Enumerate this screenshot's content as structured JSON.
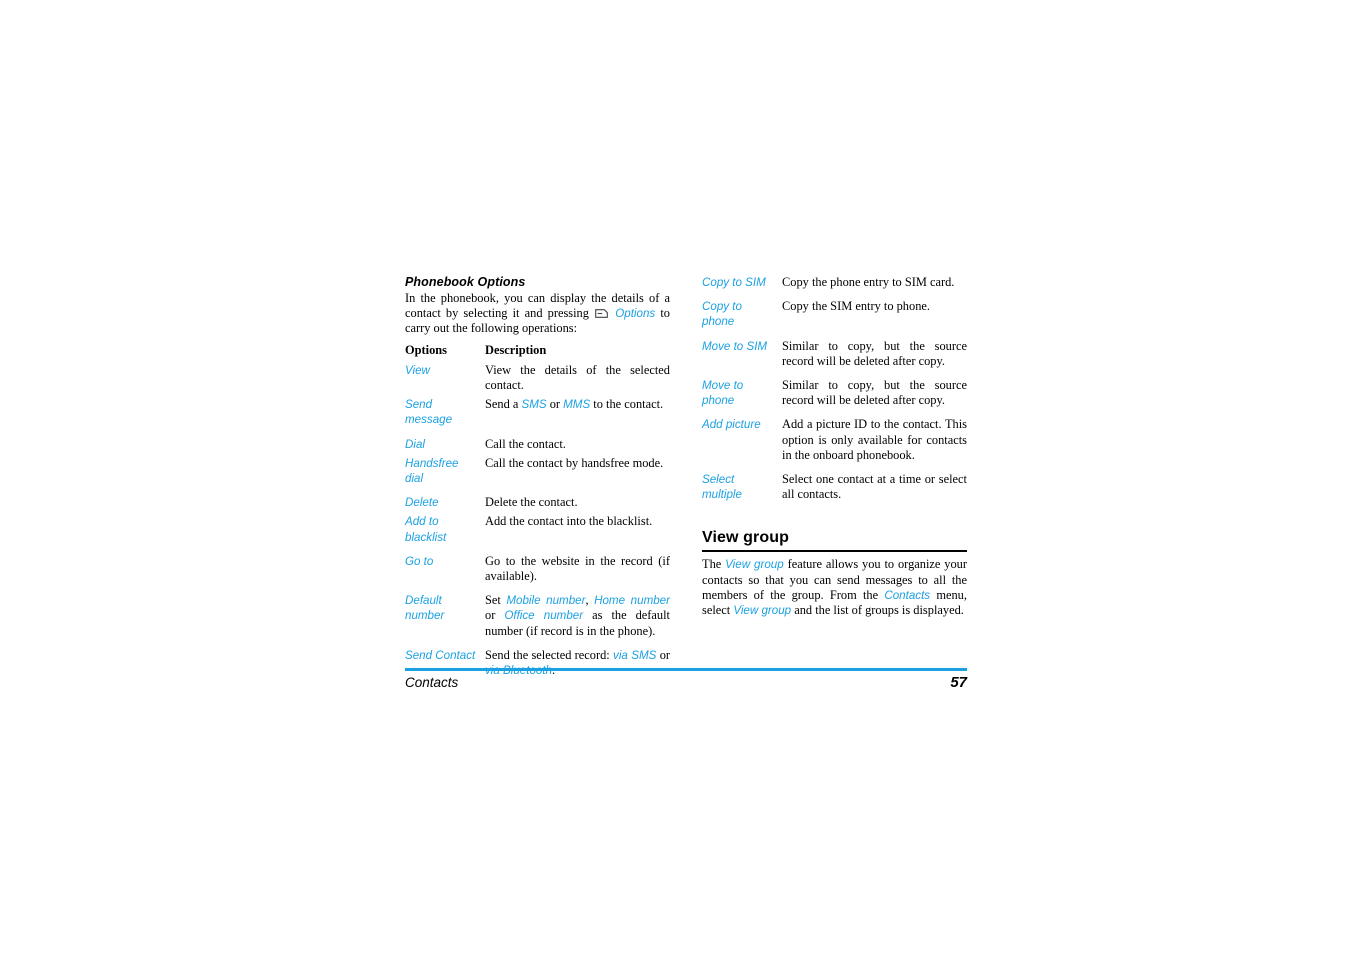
{
  "document": {
    "chapter": "Contacts",
    "page_number": "57",
    "accent_color": "#1BA1E2",
    "footer_rule_color": "#1BA1E2",
    "section_rule_color": "#000000"
  },
  "left_column": {
    "subheading": "Phonebook Options",
    "intro": {
      "part1": "In the phonebook, you can display the details of a contact by selecting it and pressing",
      "icon": "softkey-options-icon",
      "ui_term": "Options",
      "part2": "to carry out the following operations:"
    },
    "table": {
      "headers": {
        "options": "Options",
        "description": "Description"
      },
      "rows": [
        {
          "term": "View",
          "desc": "View the details of the selected contact."
        },
        {
          "term": "Send message",
          "desc_pre": "Send a ",
          "ui1": "SMS",
          "desc_mid": " or ",
          "ui2": "MMS",
          "desc_post": " to the contact."
        },
        {
          "term": "Dial",
          "desc": "Call the contact."
        },
        {
          "term": "Handsfree dial",
          "desc": "Call the contact by handsfree mode."
        },
        {
          "term": "Delete",
          "desc": "Delete the contact."
        },
        {
          "term": "Add to blacklist",
          "desc": "Add the contact into the blacklist."
        },
        {
          "term": "Go to",
          "desc": "Go to the website in the record (if available)."
        },
        {
          "term": "Default number",
          "desc_pre": "Set ",
          "ui1": "Mobile number",
          "desc_mid1": ", ",
          "ui2": "Home number",
          "desc_mid2": " or ",
          "ui3": "Office number",
          "desc_post": " as the default number (if record is in the phone)."
        },
        {
          "term": "Send Contact",
          "desc_pre": "Send the selected record: ",
          "ui1": "via SMS",
          "desc_mid": " or ",
          "ui2": "via Bluetooth",
          "desc_post": "."
        }
      ]
    }
  },
  "right_column": {
    "table_continued": {
      "rows": [
        {
          "term": "Copy to SIM",
          "desc": "Copy the phone entry to SIM card."
        },
        {
          "term": "Copy to phone",
          "desc": "Copy the SIM entry to phone."
        },
        {
          "term": "Move to SIM",
          "desc": "Similar to copy, but the source record will be deleted after copy."
        },
        {
          "term": "Move to phone",
          "desc": "Similar to copy, but the source record will be deleted after copy."
        },
        {
          "term": "Add picture",
          "desc": "Add a picture ID to the contact. This option is only available for contacts in the onboard phonebook."
        },
        {
          "term": "Select multiple",
          "desc": "Select one contact at a time or select all contacts."
        }
      ]
    },
    "section": {
      "heading": "View group",
      "paragraph": {
        "part1": "The ",
        "ui1": "View group",
        "part2": " feature allows you to organize your contacts so that you can send messages to all the members of the group. From the ",
        "ui2": "Contacts",
        "part3": " menu, select ",
        "ui3": "View group",
        "part4": " and the list of groups is displayed."
      }
    }
  }
}
